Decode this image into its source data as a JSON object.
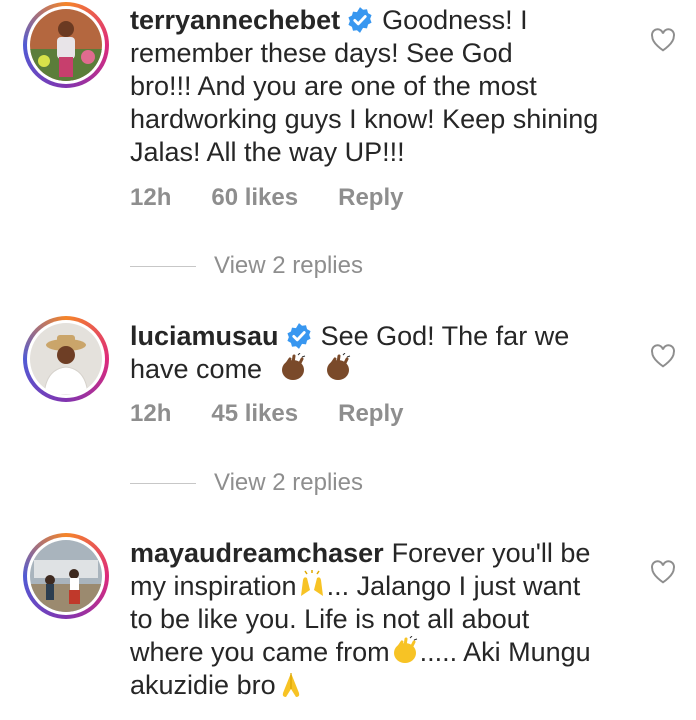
{
  "comments": [
    {
      "username": "terryannechebet",
      "verified": true,
      "text_lines": [
        "Goodness! I",
        "remember these days! See God",
        "bro!!! And you are one of the most",
        "hardworking guys I know! Keep shining",
        "Jalas! All the way UP!!!"
      ],
      "time": "12h",
      "likes": "60 likes",
      "reply_label": "Reply",
      "view_replies": "View 2 replies"
    },
    {
      "username": "luciamusau",
      "verified": true,
      "text_lines": [
        "See God! The far we",
        "have come"
      ],
      "time": "12h",
      "likes": "45 likes",
      "reply_label": "Reply",
      "view_replies": "View 2 replies"
    },
    {
      "username": "mayaudreamchaser",
      "verified": false,
      "text_lines": [
        "Forever you'll be",
        "my inspiration",
        "... Jalango I just want",
        "to be like you. Life is not all about",
        "where you came from",
        "..... Aki Mungu",
        "akuzidie bro"
      ]
    }
  ],
  "icons": {
    "heart": "heart-outline-icon",
    "verified": "verified-badge-icon",
    "clap": "clapping-hands-emoji",
    "raised_hands": "raised-hands-emoji",
    "pray": "folded-hands-emoji"
  },
  "colors": {
    "text": "#262626",
    "meta": "#8e8e8e",
    "verified": "#3897f0",
    "emoji": "#f7c325"
  }
}
